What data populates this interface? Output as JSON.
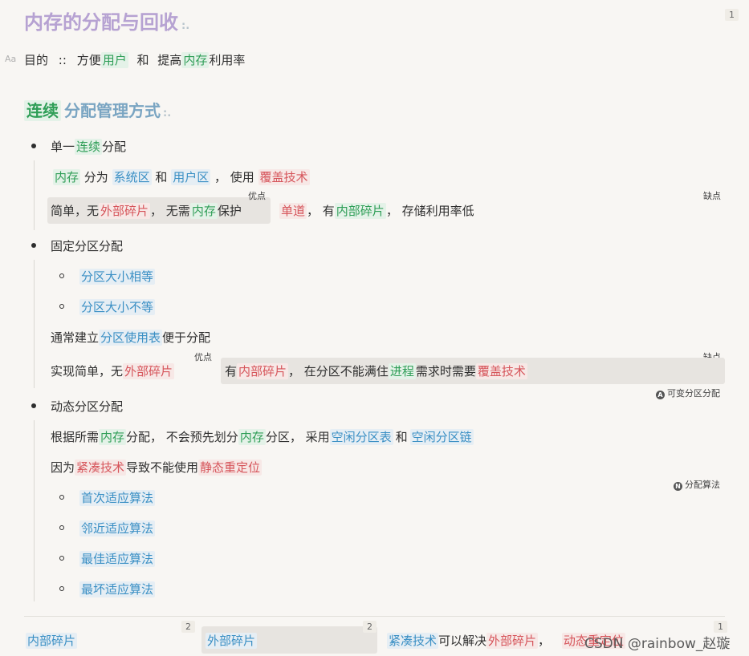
{
  "title": {
    "text": "内存的分配与回收",
    "mark": ":.",
    "badge": "1"
  },
  "aa": "Aa",
  "purpose": {
    "label": "目的",
    "sep": "::",
    "t1": "方便",
    "user": "用户",
    "t2": "和",
    "t3": "提高",
    "mem": "内存",
    "t4": "利用率"
  },
  "section": {
    "hl": "连续",
    "rest": "分配管理方式",
    "mark": ":."
  },
  "single": {
    "bullet": "单一",
    "hl": "连续",
    "tail": "分配",
    "row1": {
      "mem": "内存",
      "t1": "分为",
      "sys": "系统区",
      "t2": "和",
      "user": "用户区",
      "t3": "， 使用",
      "overlay": "覆盖技术"
    },
    "pros_label": "优点",
    "cons_label": "缺点",
    "pros": {
      "t1": "简单，无",
      "ext": "外部碎片",
      "t2": "， 无需",
      "mem": "内存",
      "t3": "保护"
    },
    "cons": {
      "single": "单道",
      "t1": "， 有",
      "int": "内部碎片",
      "t2": "， 存储利用率低"
    }
  },
  "fixed": {
    "bullet": "固定分区分配",
    "sub1": "分区大小相等",
    "sub2": "分区大小不等",
    "table": {
      "t1": "通常建立",
      "hl": "分区使用表",
      "t2": "便于分配"
    },
    "pros_label": "优点",
    "cons_label": "缺点",
    "pros": {
      "t1": "实现简单，无",
      "ext": "外部碎片"
    },
    "cons": {
      "t1": "有",
      "int": "内部碎片",
      "t2": "， 在分区不能满住",
      "proc": "进程",
      "t3": "需求时需要",
      "overlay": "覆盖技术"
    },
    "ref": {
      "icon": "A",
      "label": "可变分区分配"
    }
  },
  "dynamic": {
    "bullet": "动态分区分配",
    "row1": {
      "t1": "根据所需",
      "mem": "内存",
      "t2": "分配， 不会预先划分",
      "mem2": "内存",
      "t3": "分区， 采用",
      "free1": "空闲分区表",
      "t4": "和",
      "free2": "空闲分区链"
    },
    "row2": {
      "t1": "因为",
      "compact": "紧凑技术",
      "t2": "导致不能使用",
      "reloc": "静态重定位"
    },
    "ref": {
      "icon": "N",
      "label": "分配算法"
    },
    "algos": [
      "首次适应算法",
      "邻近适应算法",
      "最佳适应算法",
      "最坏适应算法"
    ]
  },
  "footer": {
    "c1": {
      "text": "内部碎片",
      "badge": "2"
    },
    "c2": {
      "text": "外部碎片",
      "badge": "2"
    },
    "c3": {
      "compact": "紧凑技术",
      "t1": "可以解决",
      "ext": "外部碎片",
      "t2": "，",
      "reloc": "动态重定位",
      "badge": "1"
    },
    "watermark": "CSDN @rainbow_赵璇"
  },
  "colors": {
    "green": "#2f9e57",
    "blue": "#3a8fc4",
    "red": "#d6545a",
    "title": "#b6a2d2",
    "heading": "#7aa5c2"
  }
}
